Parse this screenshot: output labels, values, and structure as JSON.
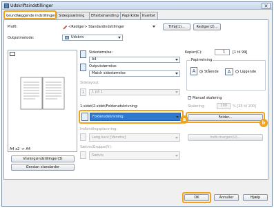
{
  "window": {
    "title": "Udskriftsindstillinger",
    "close_glyph": "✕"
  },
  "tabs": [
    "Grundlæggende indstillinger",
    "Sideopsætning",
    "Efterbehandling",
    "Papirkilde",
    "Kvalitet"
  ],
  "profile": {
    "label": "Profil:",
    "value": "<Rediger> Standardindstillinger",
    "add_button": "Tilføj(1)...",
    "edit_button": "Rediger(2)..."
  },
  "output_method": {
    "label": "Outputmetode:",
    "value": "Udskriv"
  },
  "preview": {
    "caption": "A4 x2 -> A4"
  },
  "page_size": {
    "label": "Sidestørrelse:",
    "value": "A4"
  },
  "output_size": {
    "label": "Outputstørrelse:",
    "value": "Match sidestørrelse"
  },
  "page_layout": {
    "label": "Sidelayout:",
    "value": "1 på 1"
  },
  "copies": {
    "label": "Kopier(C):",
    "value": "1",
    "range": "[1 til 99]"
  },
  "orientation": {
    "label": "Papirretning",
    "portrait": "Stående",
    "landscape": "Liggende",
    "portrait_glyph": "A",
    "landscape_glyph": "A"
  },
  "manual_scaling": {
    "label": "Manuel skalering",
    "scale_label": "Skalering:",
    "value": "100",
    "range": "% [25 til 200]"
  },
  "duplex": {
    "label": "1-sidet/2-sidet/Folderudskrivning:",
    "value": "Folderudskrivning",
    "folder_button": "Folder..."
  },
  "binding": {
    "label": "Indbindingsplacering:",
    "value": "Lang kant [Venstre]",
    "margin_button": "Indb.margen(U)..."
  },
  "color": {
    "label": "Sætvis/Gruppe(V):",
    "value": "Sætvis"
  },
  "left_buttons": {
    "view": "Visningsindstillinger(3)",
    "restore": "Gendan standarder"
  },
  "footer": {
    "ok": "OK",
    "cancel": "Annuller",
    "help": "Hjælp"
  },
  "callouts": {
    "a": "a",
    "b": "b"
  },
  "colors": {
    "accent": "#f0a21b",
    "selection": "#2f79d0"
  }
}
